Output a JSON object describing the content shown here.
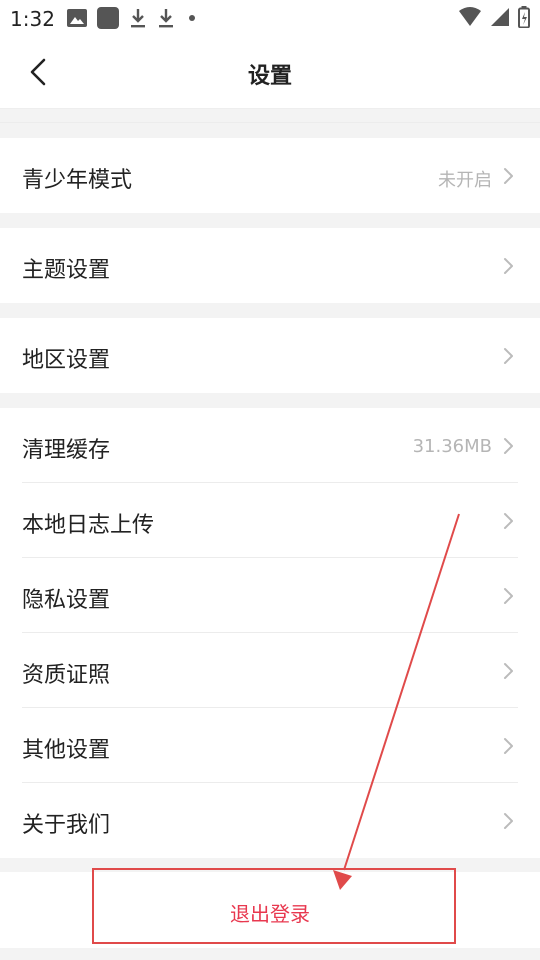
{
  "status_bar": {
    "time": "1:32",
    "icons_left": [
      "image-icon",
      "square-icon",
      "download-icon",
      "download-icon",
      "dot-icon"
    ],
    "icons_right": [
      "wifi-icon",
      "signal-icon",
      "battery-icon"
    ]
  },
  "header": {
    "title": "设置"
  },
  "sections": [
    {
      "items": [
        {
          "label": "青少年模式",
          "value": "未开启"
        }
      ]
    },
    {
      "items": [
        {
          "label": "主题设置",
          "value": ""
        }
      ]
    },
    {
      "items": [
        {
          "label": "地区设置",
          "value": ""
        }
      ]
    },
    {
      "items": [
        {
          "label": "清理缓存",
          "value": "31.36MB"
        },
        {
          "label": "本地日志上传",
          "value": ""
        },
        {
          "label": "隐私设置",
          "value": ""
        },
        {
          "label": "资质证照",
          "value": ""
        },
        {
          "label": "其他设置",
          "value": ""
        },
        {
          "label": "关于我们",
          "value": ""
        }
      ]
    }
  ],
  "logout": {
    "label": "退出登录"
  },
  "colors": {
    "accent": "#e8384f",
    "annotation": "#e04a4a",
    "background": "#f3f3f3"
  }
}
